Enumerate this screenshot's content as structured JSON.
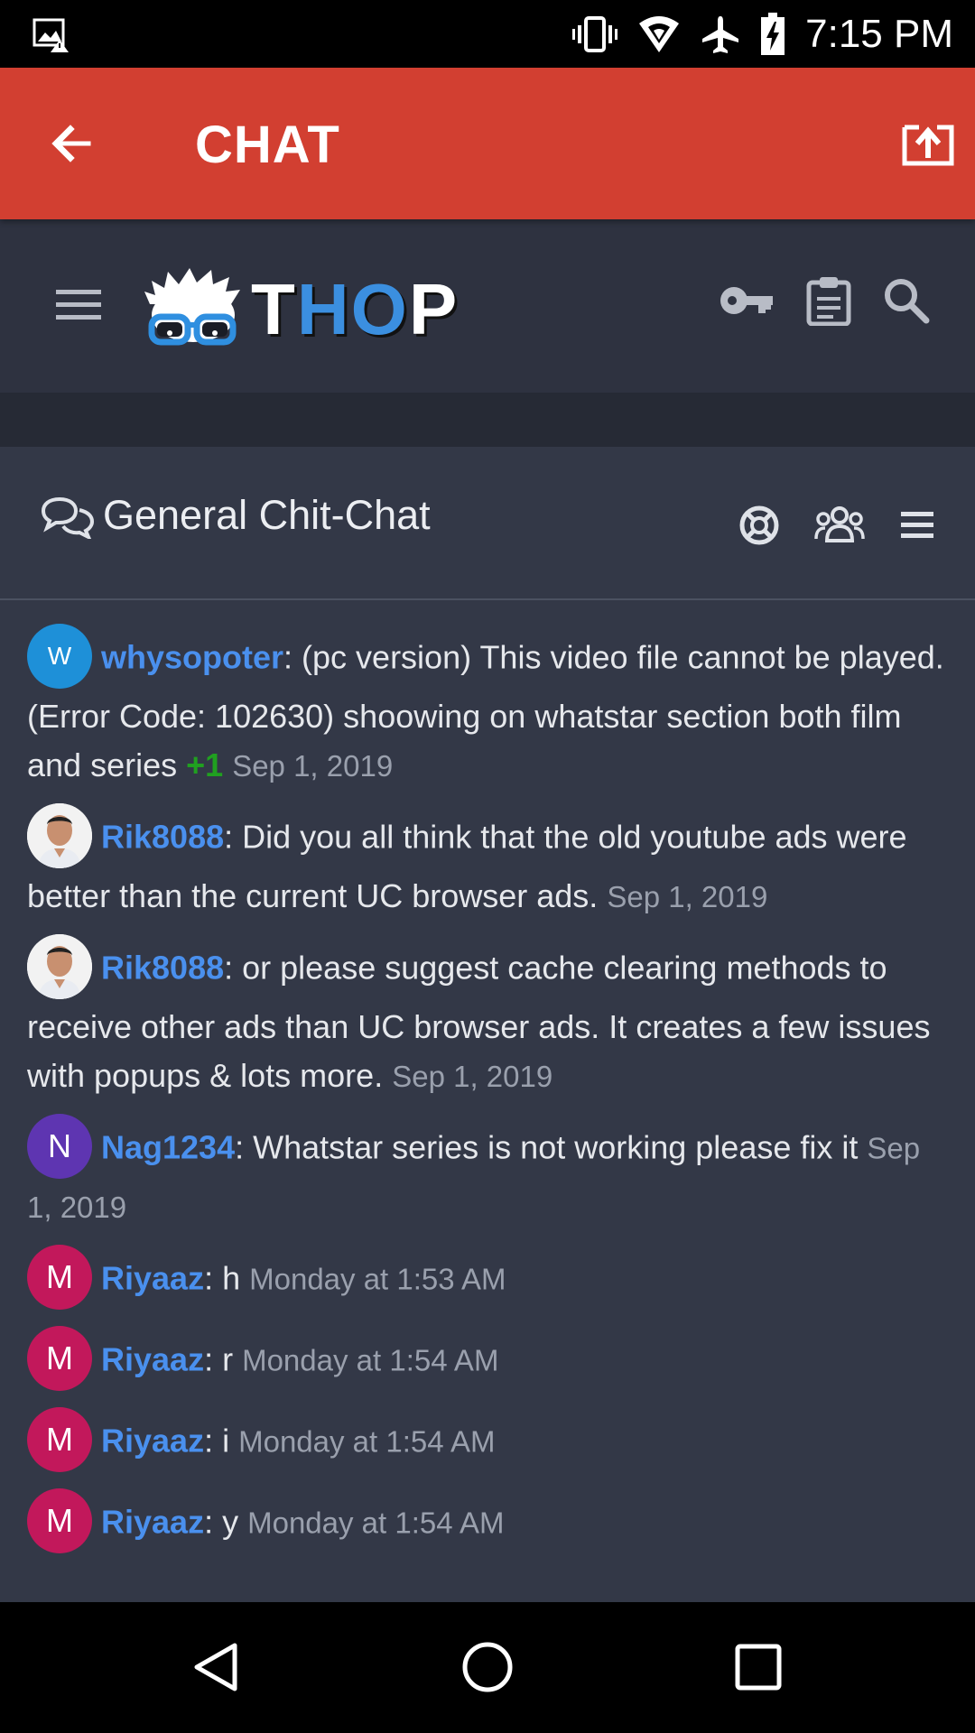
{
  "status_bar": {
    "time": "7:15 PM",
    "icons": [
      "image-warning-icon",
      "vibrate-icon",
      "wifi-icon",
      "airplane-icon",
      "battery-charging-icon"
    ]
  },
  "app_bar": {
    "title": "CHAT",
    "back_icon": "arrow-left-icon",
    "share_icon": "open-external-icon",
    "color": "#d23f31"
  },
  "site_header": {
    "logo_text_white": "T",
    "logo_text_blue": "HO",
    "logo_text_end": "P",
    "icons": [
      "menu-icon",
      "key-icon",
      "clipboard-icon",
      "search-icon"
    ]
  },
  "chat": {
    "room_title": "General Chit-Chat",
    "room_icon": "chat-bubbles-icon",
    "actions": [
      "lifebuoy-icon",
      "users-icon",
      "menu-icon"
    ],
    "messages": [
      {
        "avatar_letter": "W",
        "avatar_color": "#1e90d8",
        "user": "whysopoter",
        "text": ": (pc version) This video file cannot be played.(Error Code: 102630) shoowing on whatstar section both film and series",
        "likes": "+1",
        "time": "Sep 1, 2019"
      },
      {
        "avatar_letter": "",
        "avatar_color": "#f5f5f5",
        "user": "Rik8088",
        "text": ": Did you all think that the old youtube ads were better than the current UC browser ads.",
        "likes": "",
        "time": "Sep 1, 2019"
      },
      {
        "avatar_letter": "",
        "avatar_color": "#f5f5f5",
        "user": "Rik8088",
        "text": ": or please suggest cache clearing methods to receive other ads than UC browser ads. It creates a few issues with popups & lots more.",
        "likes": "",
        "time": "Sep 1, 2019"
      },
      {
        "avatar_letter": "N",
        "avatar_color": "#5e35b1",
        "user": "Nag1234",
        "text": ": Whatstar series is not working please fix it",
        "likes": "",
        "time": "Sep 1, 2019"
      },
      {
        "avatar_letter": "M",
        "avatar_color": "#c2185b",
        "user": "Riyaaz",
        "text": ": h",
        "likes": "",
        "time": "Monday at 1:53 AM"
      },
      {
        "avatar_letter": "M",
        "avatar_color": "#c2185b",
        "user": "Riyaaz",
        "text": ": r",
        "likes": "",
        "time": "Monday at 1:54 AM"
      },
      {
        "avatar_letter": "M",
        "avatar_color": "#c2185b",
        "user": "Riyaaz",
        "text": ": i",
        "likes": "",
        "time": "Monday at 1:54 AM"
      },
      {
        "avatar_letter": "M",
        "avatar_color": "#c2185b",
        "user": "Riyaaz",
        "text": ": y",
        "likes": "",
        "time": "Monday at 1:54 AM"
      }
    ]
  },
  "nav_bar": {
    "icons": [
      "back-triangle-icon",
      "home-circle-icon",
      "recents-square-icon"
    ]
  }
}
